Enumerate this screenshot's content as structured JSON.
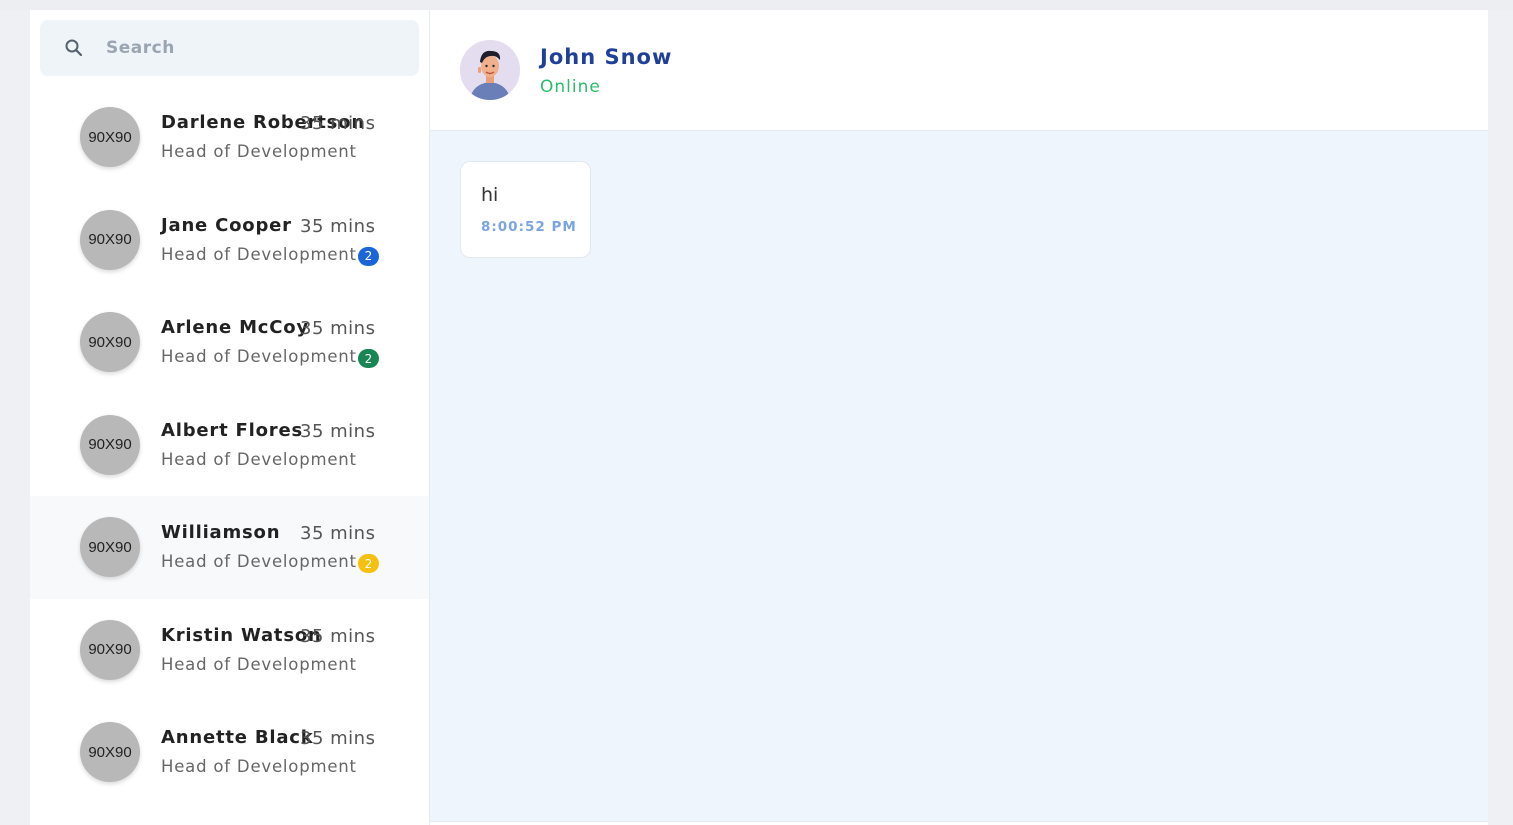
{
  "search": {
    "placeholder": "Search",
    "icon": "search-icon"
  },
  "contacts": [
    {
      "avatar": "90X90",
      "name": "Darlene Robertson",
      "time": "35 mins",
      "role": "Head of Development",
      "badge": ""
    },
    {
      "avatar": "90X90",
      "name": "Jane Cooper",
      "time": "35 mins",
      "role": "Head of Development",
      "badge": "2",
      "badge_color": "#1a66d9"
    },
    {
      "avatar": "90X90",
      "name": "Arlene McCoy",
      "time": "35 mins",
      "role": "Head of Development",
      "badge": "2",
      "badge_color": "#198754"
    },
    {
      "avatar": "90X90",
      "name": "Albert Flores",
      "time": "35 mins",
      "role": "Head of Development",
      "badge": ""
    },
    {
      "avatar": "90X90",
      "name": "Williamson",
      "time": "35 mins",
      "role": "Head of Development",
      "badge": "2",
      "badge_color": "#f5c10e"
    },
    {
      "avatar": "90X90",
      "name": "Kristin Watson",
      "time": "35 mins",
      "role": "Head of Development",
      "badge": ""
    },
    {
      "avatar": "90X90",
      "name": "Annette Black",
      "time": "35 mins",
      "role": "Head of Development",
      "badge": ""
    }
  ],
  "active_contact_index": 4,
  "chat": {
    "name": "John Snow",
    "status": "Online",
    "messages": [
      {
        "text": "hi",
        "time": "8:00:52 PM"
      }
    ]
  },
  "colors": {
    "accent_name": "#1f3f99",
    "online": "#2bbd6a",
    "chat_bg": "#eff5fd",
    "message_time": "#7ba4e0"
  }
}
